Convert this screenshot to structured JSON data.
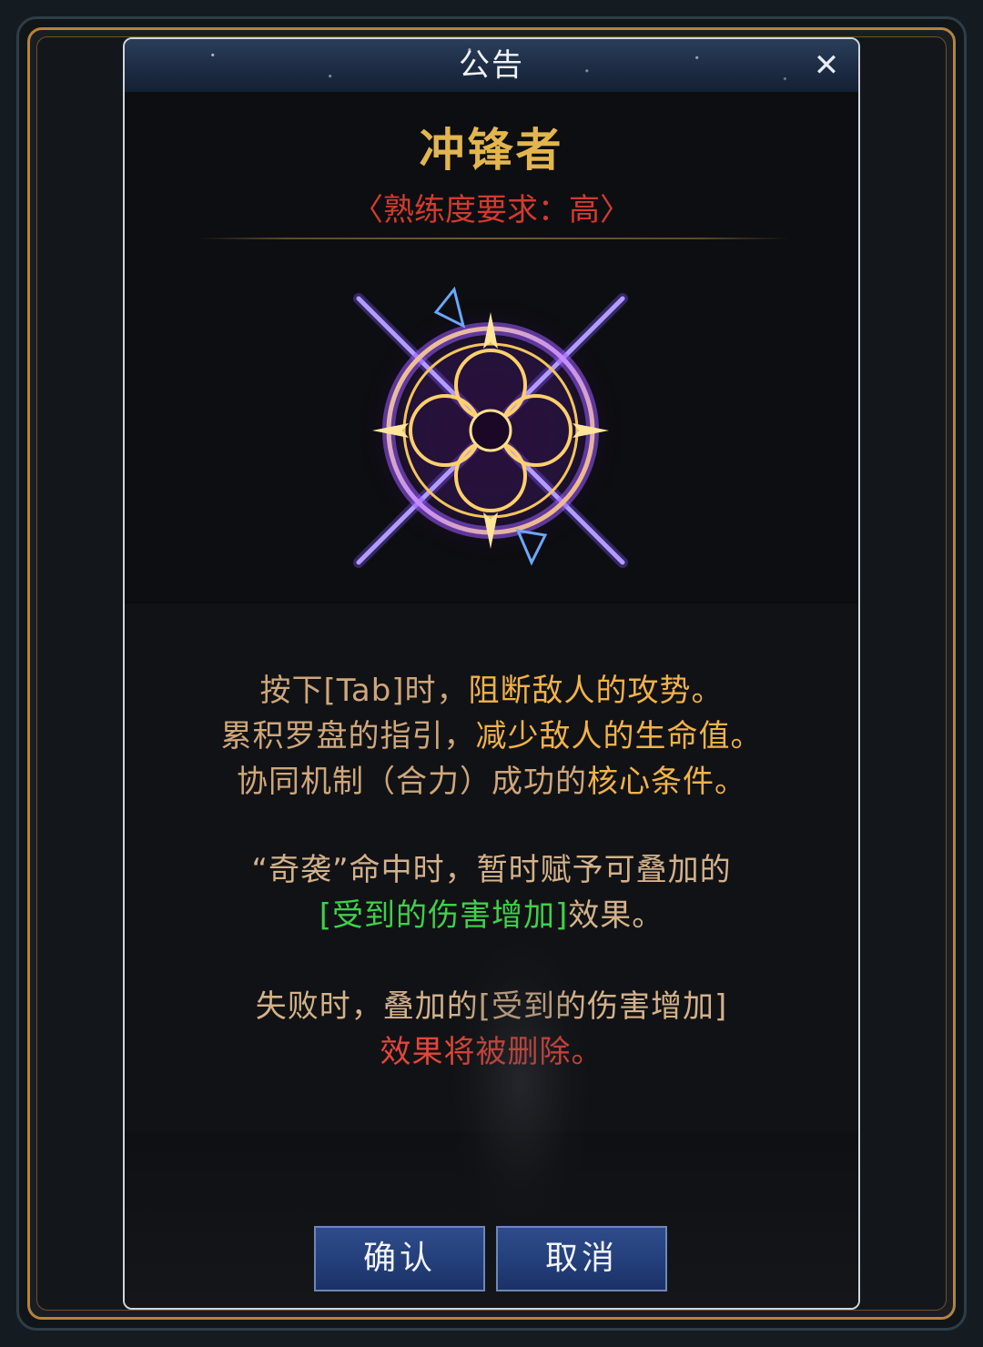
{
  "dialog": {
    "title": "公告",
    "close_icon": "close-icon"
  },
  "skill": {
    "name": "冲锋者",
    "proficiency": "〈熟练度要求：高〉",
    "emblem_icon": "compass-emblem-icon"
  },
  "description": {
    "line1_a": "按下[Tab]时，",
    "line1_b": "阻断敌人的攻势。",
    "line2_a": "累积罗盘的指引，",
    "line2_b": "减少敌人的生命值。",
    "line3_a": "协同机制（合力）成功的",
    "line3_b": "核心条件。",
    "line4": "“奇袭”命中时，暂时赋予可叠加的",
    "line5_a": "[受到的伤害增加]",
    "line5_b": "效果。",
    "line6": "失败时，叠加的[受到的伤害增加]",
    "line7": "效果将被删除。"
  },
  "buttons": {
    "confirm": "确认",
    "cancel": "取消"
  },
  "colors": {
    "title_gold": "#e2b64f",
    "requirement_red": "#d23a30",
    "highlight_gold": "#f0b24a",
    "buff_green": "#3fd04a",
    "warning_red": "#e2473a",
    "button_blue": "#24407c"
  }
}
